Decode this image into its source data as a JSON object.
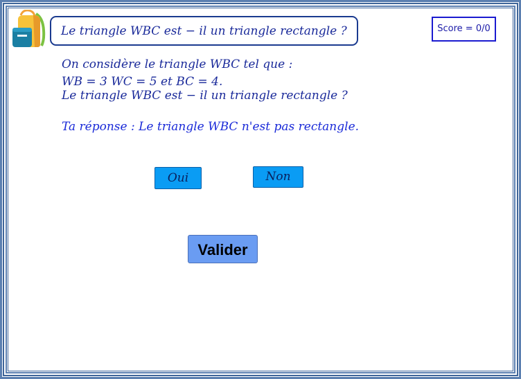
{
  "header": {
    "title": "Le triangle WBC est − il un triangle rectangle ?",
    "score": "Score = 0/0"
  },
  "statement": {
    "line1": "On considère le triangle WBC tel que :",
    "line2": "WB = 3     WC = 5      et      BC = 4.",
    "line3": "Le triangle WBC est − il un triangle rectangle ?"
  },
  "answer": {
    "text": "Ta réponse :  Le triangle WBC n'est pas rectangle."
  },
  "choices": {
    "oui_label": "Oui",
    "non_label": "Non"
  },
  "actions": {
    "validate_label": "Valider"
  },
  "colors": {
    "frame": "#4a6fa0",
    "title_text": "#1a2a9a",
    "answer_text": "#1a2ad8",
    "choice_button": "#0a9cf4",
    "validate_button": "#6a9cf2"
  },
  "icons": {
    "logo": "backpack-icon"
  }
}
